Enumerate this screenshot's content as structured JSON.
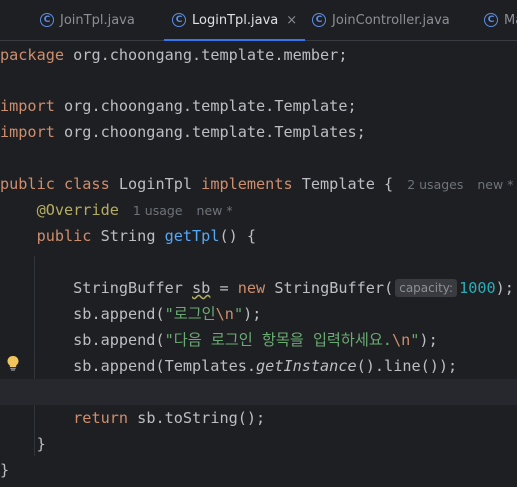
{
  "tabs": [
    {
      "label": "JoinTpl.java",
      "icon": "C"
    },
    {
      "label": "LoginTpl.java",
      "icon": "C",
      "close": "×"
    },
    {
      "label": "JoinController.java",
      "icon": "C"
    },
    {
      "label": "Ma",
      "icon": "C"
    }
  ],
  "code": {
    "l1_kw": "package",
    "l1_rest": " org.choongang.template.member;",
    "l3_kw": "import",
    "l3_rest": " org.choongang.template.Template;",
    "l4_kw": "import",
    "l4_rest": " org.choongang.template.Templates;",
    "l6_kw1": "public class",
    "l6_name": " LoginTpl ",
    "l6_kw2": "implements",
    "l6_rest": " Template {",
    "l6_hint1": "2 usages",
    "l6_hint2": "new *",
    "l7_ann": "@Override",
    "l7_hint1": "1 usage",
    "l7_hint2": "new *",
    "l8_kw": "public",
    "l8_type": " String ",
    "l8_fn": "getTpl",
    "l8_rest": "() {",
    "l10_a": "StringBuffer ",
    "l10_var": "sb",
    "l10_b": " = ",
    "l10_kw": "new",
    "l10_c": " StringBuffer(",
    "l10_param": "capacity:",
    "l10_num": "1000",
    "l10_d": ");",
    "l11_a": "sb.append(",
    "l11_str": "\"로그인",
    "l11_esc": "\\n",
    "l11_str2": "\"",
    "l11_b": ");",
    "l12_a": "sb.append(",
    "l12_str": "\"다음 로그인 항목을 입력하세요.",
    "l12_esc": "\\n",
    "l12_str2": "\"",
    "l12_b": ");",
    "l13_a": "sb.append(Templates.",
    "l13_ital": "getInstance",
    "l13_b": "().line());",
    "l15_kw": "return",
    "l15_rest": " sb.toString();",
    "l16": "}",
    "l17": "}"
  }
}
